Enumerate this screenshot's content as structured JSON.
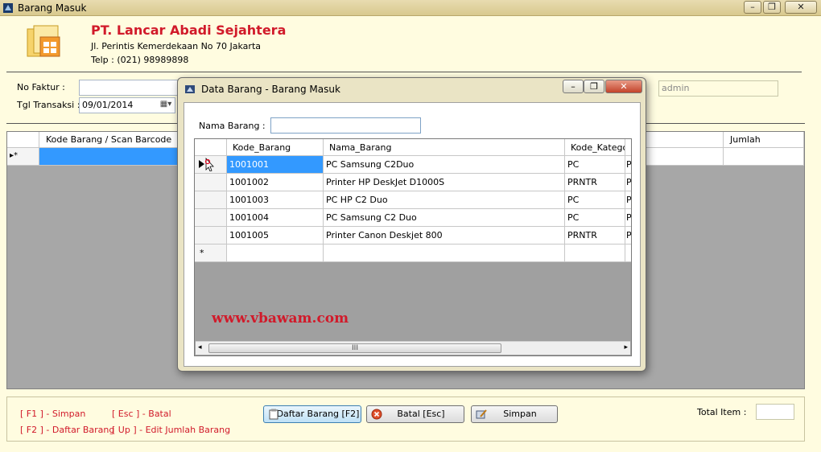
{
  "window": {
    "title": "Barang Masuk"
  },
  "company": {
    "name": "PT. Lancar Abadi Sejahtera",
    "address": "Jl. Perintis Kemerdekaan No 70 Jakarta",
    "phone": "Telp : (021) 98989898"
  },
  "form": {
    "no_faktur_label": "No Faktur :",
    "no_faktur_value": "",
    "tgl_label": "Tgl Transaksi :",
    "tgl_value": "09/01/2014",
    "user_value": "admin"
  },
  "main_grid": {
    "columns": [
      "Kode Barang / Scan Barcode",
      "Jumlah"
    ],
    "new_row_marker": "▸*"
  },
  "shortcuts": [
    "[ F1 ] - Simpan",
    "[ Esc ] - Batal",
    "[ F2 ] - Daftar Barang",
    "[ Up ] - Edit Jumlah Barang"
  ],
  "buttons": {
    "daftar": "Daftar Barang [F2]",
    "batal": "Batal [Esc]",
    "simpan": "Simpan"
  },
  "total_label": "Total Item :",
  "total_value": "",
  "dialog": {
    "title": "Data Barang - Barang Masuk",
    "search_label": "Nama Barang :",
    "search_value": "",
    "columns": [
      "Kode_Barang",
      "Nama_Barang",
      "Kode_Kategori",
      ""
    ],
    "rows": [
      [
        "1001001",
        "PC Samsung C2Duo",
        "PC",
        "P"
      ],
      [
        "1001002",
        "Printer HP DeskJet D1000S",
        "PRNTR",
        "P"
      ],
      [
        "1001003",
        "PC HP C2 Duo",
        "PC",
        "P"
      ],
      [
        "1001004",
        "PC Samsung C2 Duo",
        "PC",
        "P"
      ],
      [
        "1001005",
        "Printer Canon Deskjet 800",
        "PRNTR",
        "P"
      ]
    ],
    "new_row_marker": "*",
    "watermark": "www.vbawam.com"
  },
  "colors": {
    "accent_red": "#d11a2a",
    "selection": "#3399ff",
    "panel_bg": "#fffce0"
  }
}
